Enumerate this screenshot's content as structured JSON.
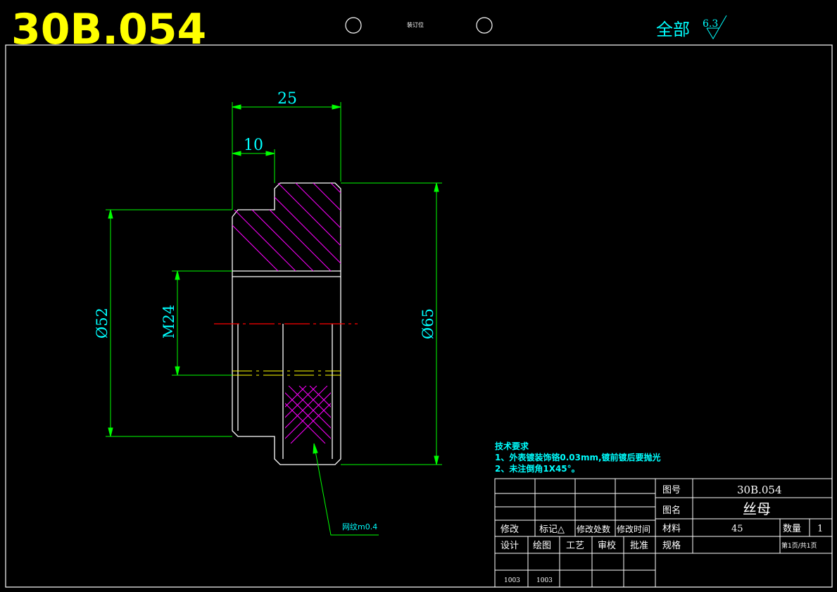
{
  "header": {
    "drawing_code": "30B.054",
    "binding_label": "装订位",
    "roughness_prefix": "全部",
    "roughness_value": "6.3"
  },
  "dimensions": {
    "overall_width": "25",
    "step_width": "10",
    "bore_diameter": "Ø52",
    "thread": "M24",
    "outer_diameter": "Ø65"
  },
  "knurl_note": "网纹m0.4",
  "tech_requirements": {
    "title": "技术要求",
    "line1": "1、外表镀装饰铬0.03mm,镀前镀后要抛光",
    "line2": "2、未注倒角1X45°。"
  },
  "title_block": {
    "rev_labels": [
      "修改",
      "标记△",
      "修改处数",
      "修改时间"
    ],
    "sign_labels": [
      "设计",
      "绘图",
      "工艺",
      "审校",
      "批准"
    ],
    "sign_values": [
      "1003",
      "1003"
    ],
    "drawing_no_label": "图号",
    "drawing_no": "30B.054",
    "name_label": "图名",
    "name": "丝母",
    "material_label": "材料",
    "material": "45",
    "quantity_label": "数量",
    "quantity": "1",
    "spec_label": "规格",
    "page_info": "第1页/共1页"
  },
  "colors": {
    "frame": "#ffffff",
    "dimension": "#00ff00",
    "dimension_text": "#00ffff",
    "hatch": "#ff00ff",
    "centerline": "#ff0000",
    "hidden": "#ffff00",
    "title": "#ffff00"
  }
}
